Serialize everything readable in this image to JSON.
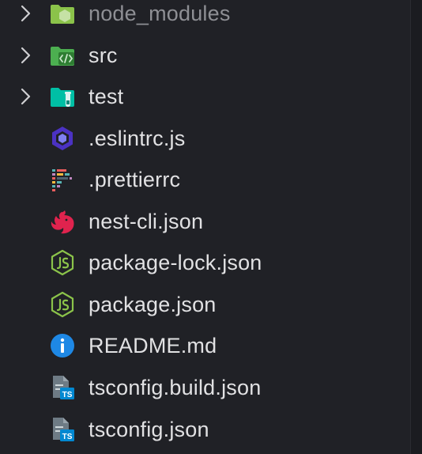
{
  "explorer": {
    "items": [
      {
        "label": "node_modules",
        "type": "folder",
        "icon": "node-folder-icon",
        "dimmed": true
      },
      {
        "label": "src",
        "type": "folder",
        "icon": "source-folder-icon"
      },
      {
        "label": "test",
        "type": "folder",
        "icon": "test-folder-icon"
      },
      {
        "label": ".eslintrc.js",
        "type": "file",
        "icon": "eslint-icon"
      },
      {
        "label": ".prettierrc",
        "type": "file",
        "icon": "prettier-icon"
      },
      {
        "label": "nest-cli.json",
        "type": "file",
        "icon": "nestjs-icon"
      },
      {
        "label": "package-lock.json",
        "type": "file",
        "icon": "nodejs-icon"
      },
      {
        "label": "package.json",
        "type": "file",
        "icon": "nodejs-icon"
      },
      {
        "label": "README.md",
        "type": "file",
        "icon": "info-icon"
      },
      {
        "label": "tsconfig.build.json",
        "type": "file",
        "icon": "tsconfig-icon"
      },
      {
        "label": "tsconfig.json",
        "type": "file",
        "icon": "tsconfig-icon"
      }
    ],
    "colors": {
      "background": "#202126",
      "text": "#e1e1e3",
      "dimmed_text": "#8e8f94",
      "chevron": "#cfcfd2",
      "node_folder": "#8bc34a",
      "src_folder": "#4caf50",
      "test_folder": "#00bfa5",
      "eslint": "#4b32c3",
      "nest": "#e0234e",
      "nodejs": "#8bc34a",
      "info": "#1e88e5",
      "typescript": "#0288d1"
    },
    "tsconfig_badge": "TS"
  }
}
